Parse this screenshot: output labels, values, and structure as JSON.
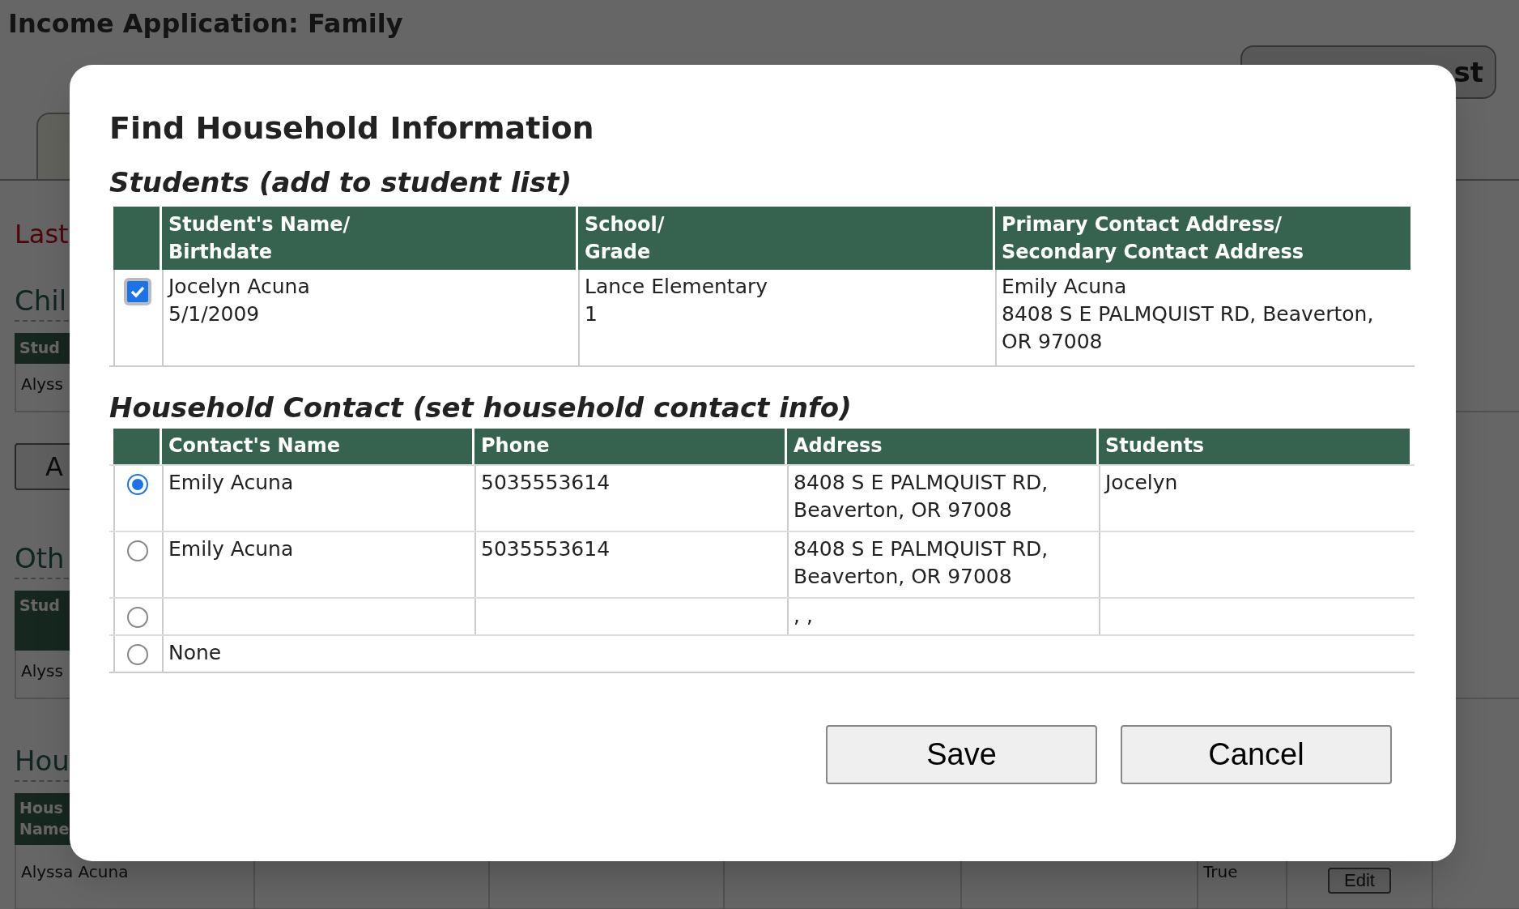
{
  "page": {
    "title": "Income Application: Family",
    "top_button": "st",
    "name_label": "Last",
    "sections": [
      {
        "heading": "Chil",
        "header": [
          "Stud"
        ],
        "row": "Alyss",
        "button": "A"
      },
      {
        "heading": "Oth",
        "header": [
          "Stud"
        ],
        "row": "Alyss"
      },
      {
        "heading": "Hou",
        "header": [
          "Hous",
          "Name"
        ],
        "row": "Alyssa Acuna",
        "flag": "True",
        "row_button": "Edit"
      }
    ]
  },
  "dialog": {
    "title": "Find Household Information",
    "students": {
      "heading": "Students (add to student list)",
      "columns": [
        [
          "Student's Name/",
          "Birthdate"
        ],
        [
          "School/",
          "Grade"
        ],
        [
          "Primary Contact Address/",
          "Secondary Contact Address"
        ]
      ],
      "rows": [
        {
          "checked": true,
          "name": [
            "Jocelyn Acuna",
            "5/1/2009"
          ],
          "school": [
            "Lance Elementary",
            "1"
          ],
          "address": [
            "Emily Acuna",
            "8408 S E PALMQUIST RD, Beaverton,",
            "OR 97008"
          ]
        }
      ]
    },
    "contacts": {
      "heading": "Household Contact (set household contact info)",
      "columns": [
        "Contact's Name",
        "Phone",
        "Address",
        "Students"
      ],
      "rows": [
        {
          "kind": "contact",
          "selected": true,
          "name": "Emily Acuna",
          "phone": "5035553614",
          "address": [
            "8408 S E PALMQUIST RD,",
            "Beaverton, OR 97008"
          ],
          "students": "Jocelyn"
        },
        {
          "kind": "contact",
          "selected": false,
          "name": "Emily Acuna",
          "phone": "5035553614",
          "address": [
            "8408 S E PALMQUIST RD,",
            "Beaverton, OR 97008"
          ]
        },
        {
          "kind": "contact",
          "selected": false,
          "address": [
            ", ,"
          ]
        },
        {
          "kind": "none",
          "selected": false,
          "name": "None"
        }
      ]
    },
    "buttons": [
      "Save",
      "Cancel"
    ]
  }
}
